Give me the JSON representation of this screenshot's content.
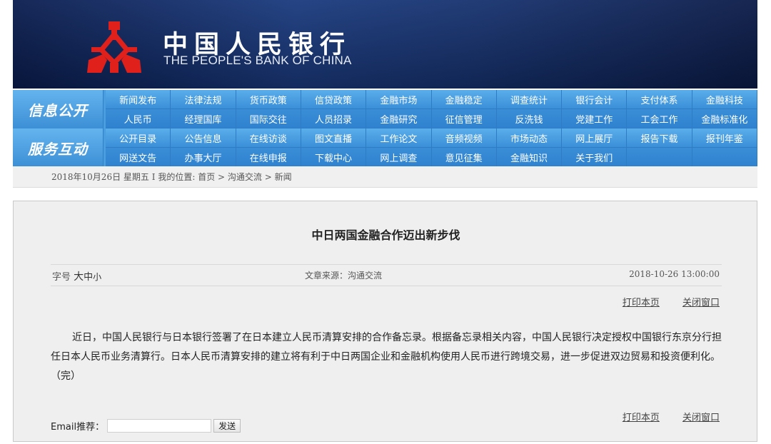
{
  "header": {
    "bank_name_cn": "中国人民银行",
    "bank_name_en": "THE PEOPLE'S BANK OF CHINA",
    "logo_icon": "pboc-logo-icon",
    "colors": {
      "banner": "#1a3a7e",
      "logo": "#e0201a"
    }
  },
  "nav": {
    "info": {
      "heading": "信息公开",
      "items": [
        "新闻发布",
        "法律法规",
        "货币政策",
        "信贷政策",
        "金融市场",
        "金融稳定",
        "调查统计",
        "银行会计",
        "支付体系",
        "金融科技",
        "人民币",
        "经理国库",
        "国际交往",
        "人员招录",
        "金融研究",
        "征信管理",
        "反洗钱",
        "党建工作",
        "工会工作",
        "金融标准化"
      ]
    },
    "service": {
      "heading": "服务互动",
      "items": [
        "公开目录",
        "公告信息",
        "在线访谈",
        "图文直播",
        "工作论文",
        "音频视频",
        "市场动态",
        "网上展厅",
        "报告下载",
        "报刊年鉴",
        "网送文告",
        "办事大厅",
        "在线申报",
        "下载中心",
        "网上调查",
        "意见征集",
        "金融知识",
        "关于我们",
        "",
        ""
      ]
    },
    "colors": {
      "bar": "#4a9ee0"
    }
  },
  "breadcrumb": {
    "date": "2018年10月26日 星期五",
    "separator": "I",
    "location_label": "我的位置:",
    "crumbs": [
      "首页",
      "沟通交流",
      "新闻"
    ],
    "arrow": ">"
  },
  "article": {
    "title": "中日两国金融合作迈出新步伐",
    "font_size_label": "字号",
    "font_size_large": "大",
    "font_size_medium": "中",
    "font_size_small": "小",
    "source": "文章来源：沟通交流",
    "datetime": "2018-10-26 13:00:00",
    "print_label": "打印本页",
    "close_label": "关闭窗口",
    "body": "近日，中国人民银行与日本银行签署了在日本建立人民币清算安排的合作备忘录。根据备忘录相关内容，中国人民银行决定授权中国银行东京分行担任日本人民币业务清算行。日本人民币清算安排的建立将有利于中日两国企业和金融机构使用人民币进行跨境交易，进一步促进双边贸易和投资便利化。（完）"
  },
  "email": {
    "label": "Email推荐：",
    "value": "",
    "send_label": "发送"
  }
}
